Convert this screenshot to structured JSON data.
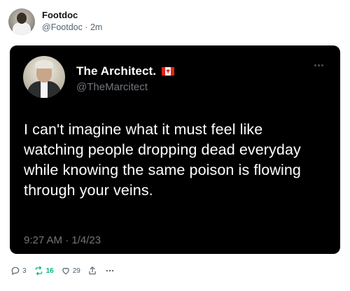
{
  "post": {
    "author_name": "Footdoc",
    "author_handle": "@Footdoc",
    "separator": " · ",
    "age": "2m"
  },
  "quoted": {
    "author_name": "The Architect.",
    "author_handle": "@TheMarcitect",
    "flag_icon": "canada-flag-icon",
    "text": "I can't imagine what it must feel like watching people dropping dead everyday while knowing the same poison is flowing through your veins.",
    "timestamp": "9:27 AM · 1/4/23"
  },
  "actions": {
    "reply_count": "3",
    "retweet_count": "16",
    "like_count": "29"
  },
  "colors": {
    "retweet": "#00ba7c",
    "card_bg": "#000000",
    "muted": "#536471"
  }
}
